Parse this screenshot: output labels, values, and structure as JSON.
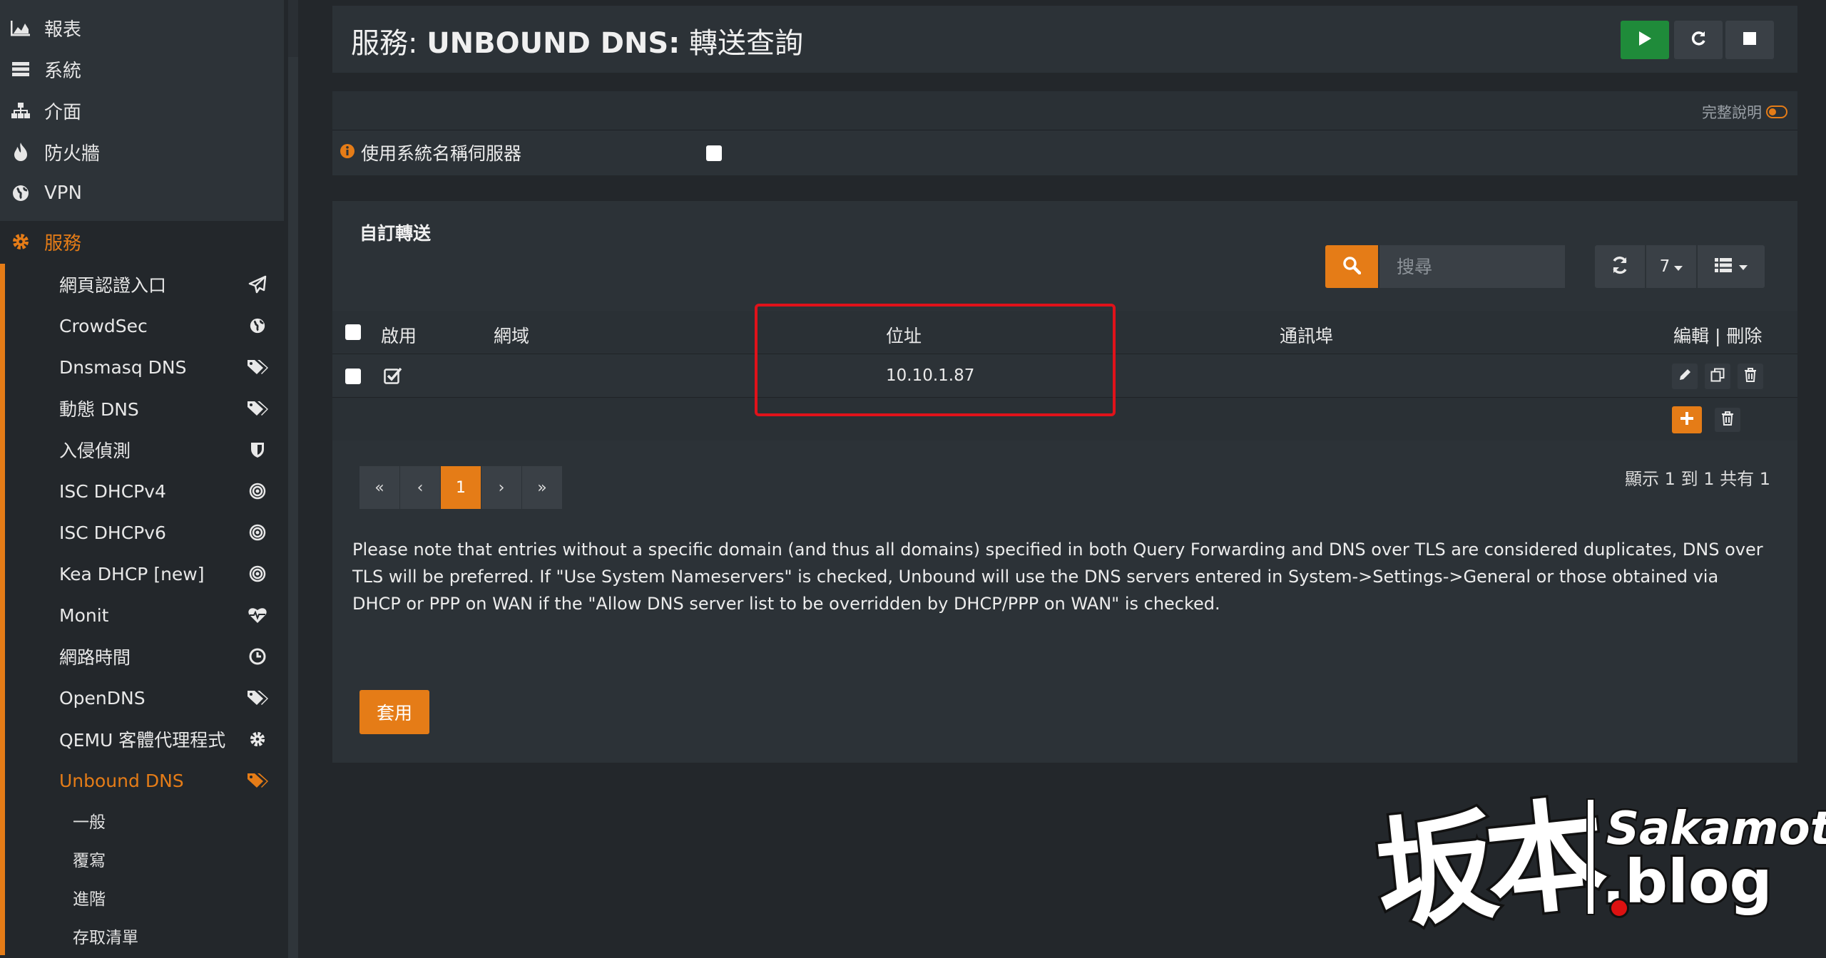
{
  "sidebar": {
    "top_items": [
      {
        "label": "報表",
        "icon": "area-chart-icon"
      },
      {
        "label": "系統",
        "icon": "server-icon"
      },
      {
        "label": "介面",
        "icon": "sitemap-icon"
      },
      {
        "label": "防火牆",
        "icon": "fire-icon"
      },
      {
        "label": "VPN",
        "icon": "globe-icon"
      }
    ],
    "services": {
      "label": "服務",
      "icon": "cog-icon"
    },
    "sub_items": [
      {
        "label": "網頁認證入口",
        "icon": "paper-plane-icon"
      },
      {
        "label": "CrowdSec",
        "icon": "globe-icon"
      },
      {
        "label": "Dnsmasq DNS",
        "icon": "tags-icon"
      },
      {
        "label": "動態 DNS",
        "icon": "tags-icon"
      },
      {
        "label": "入侵偵測",
        "icon": "shield-icon"
      },
      {
        "label": "ISC DHCPv4",
        "icon": "bullseye-icon"
      },
      {
        "label": "ISC DHCPv6",
        "icon": "bullseye-icon"
      },
      {
        "label": "Kea DHCP [new]",
        "icon": "bullseye-icon"
      },
      {
        "label": "Monit",
        "icon": "heartbeat-icon"
      },
      {
        "label": "網路時間",
        "icon": "clock-icon"
      },
      {
        "label": "OpenDNS",
        "icon": "tags-icon"
      },
      {
        "label": "QEMU 客體代理程式",
        "icon": "cog-icon"
      },
      {
        "label": "Unbound DNS",
        "icon": "tags-icon"
      }
    ],
    "unbound_sub": [
      "一般",
      "覆寫",
      "進階",
      "存取清單"
    ]
  },
  "header": {
    "title_prefix": "服務: ",
    "title_bold": "UNBOUND DNS:",
    "title_suffix": " 轉送查詢"
  },
  "general": {
    "full_help": "完整說明",
    "use_system_ns": "使用系統名稱伺服器"
  },
  "forward": {
    "title": "自訂轉送",
    "search_placeholder": "搜尋",
    "rows_per_page": "7",
    "columns": {
      "enabled": "啟用",
      "domain": "網域",
      "address": "位址",
      "port": "通訊埠",
      "actions": "編輯 | 刪除"
    },
    "rows": [
      {
        "enabled": true,
        "domain": "",
        "address": "10.10.1.87",
        "port": ""
      }
    ],
    "pager": [
      "«",
      "‹",
      "1",
      "›",
      "»"
    ],
    "page_info": "顯示 1 到 1 共有 1",
    "note": "Please note that entries without a specific domain (and thus all domains) specified in both Query Forwarding and DNS over TLS are considered duplicates, DNS over TLS will be preferred. If \"Use System Nameservers\" is checked, Unbound will use the DNS servers entered in System->Settings->General or those obtained via DHCP or PPP on WAN if the \"Allow DNS server list to be overridden by DHCP/PPP on WAN\" is checked.",
    "apply": "套用"
  },
  "watermark": {
    "kanji": "坂本",
    "top": "Sakamoto",
    "bottom": ".blog"
  },
  "colors": {
    "accent": "#e57c17",
    "play": "#1f8b3a",
    "highlight": "#e0121a"
  }
}
